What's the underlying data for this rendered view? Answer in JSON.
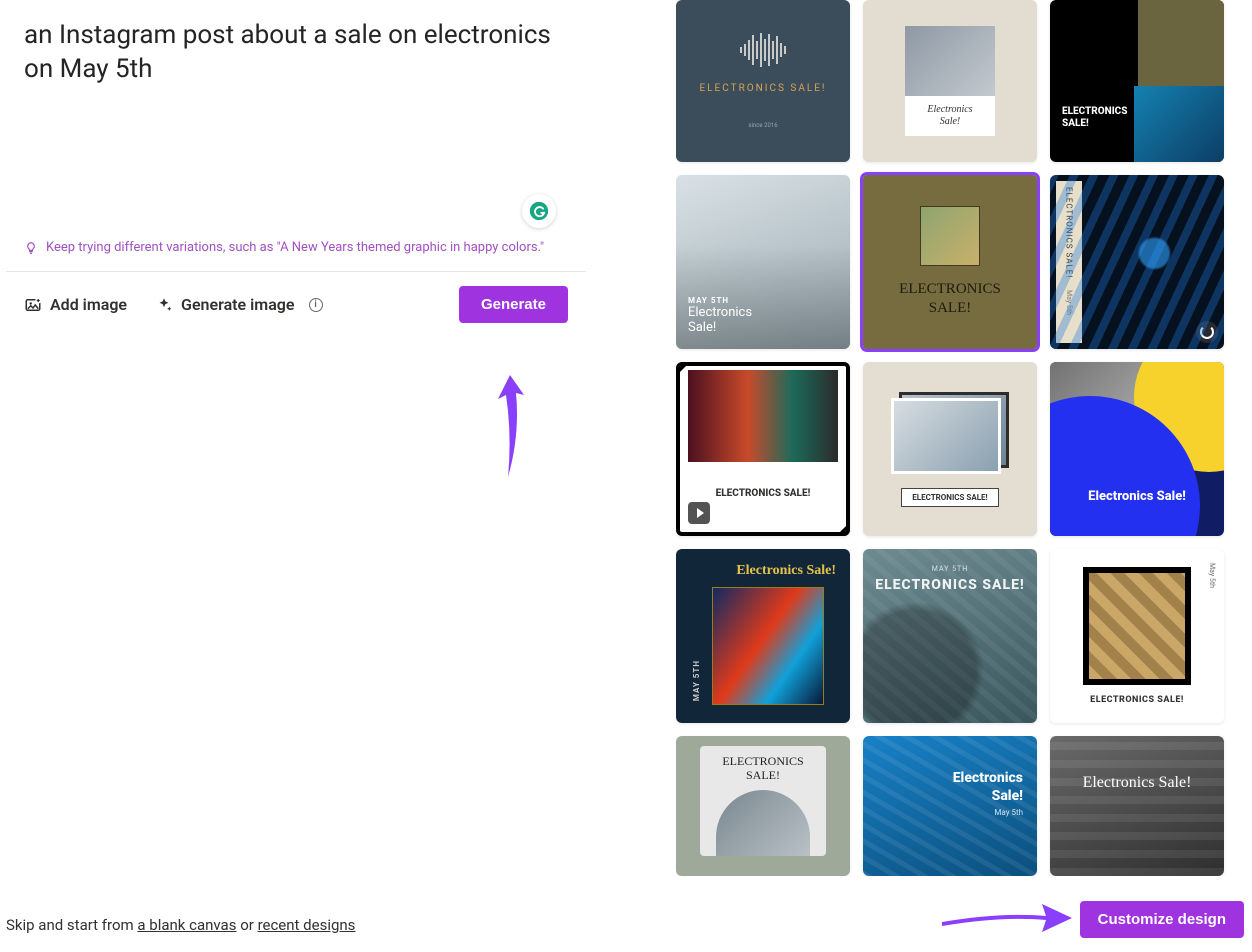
{
  "prompt": {
    "text": "an Instagram post about a sale on electronics on May 5th",
    "hint": "Keep trying different variations, such as \"A New Years themed graphic in happy colors.\""
  },
  "actions": {
    "add_image": "Add image",
    "generate_image": "Generate image",
    "generate": "Generate"
  },
  "footer": {
    "prefix": "Skip and start from ",
    "blank": "a blank canvas",
    "or": " or ",
    "recent": "recent designs",
    "customize": "Customize design"
  },
  "tiles": {
    "t1": {
      "title": "ELECTRONICS SALE!",
      "sub": "since 2016"
    },
    "t2": {
      "line1": "Electronics",
      "line2": "Sale!"
    },
    "t3": {
      "line1": "ELECTRONICS",
      "line2": "SALE!"
    },
    "t4": {
      "date": "MAY 5TH",
      "line1": "Electronics",
      "line2": "Sale!"
    },
    "t5": {
      "line1": "ELECTRONICS",
      "line2": "SALE!"
    },
    "t6": {
      "v1": "ELECTRONICS SALE!",
      "v2": "May 5th"
    },
    "t7": {
      "title": "ELECTRONICS SALE!"
    },
    "t8": {
      "title": "ELECTRONICS SALE!"
    },
    "t9": {
      "title": "Electronics Sale!"
    },
    "t10": {
      "title": "Electronics Sale!",
      "date": "MAY 5TH"
    },
    "t11": {
      "date": "MAY 5TH",
      "title": "ELECTRONICS SALE!"
    },
    "t12": {
      "title": "ELECTRONICS SALE!",
      "side": "May 5th"
    },
    "t13": {
      "line1": "ELECTRONICS",
      "line2": "SALE!"
    },
    "t14": {
      "line1": "Electronics",
      "line2": "Sale!",
      "date": "May 5th"
    },
    "t15": {
      "title": "Electronics Sale!"
    }
  }
}
